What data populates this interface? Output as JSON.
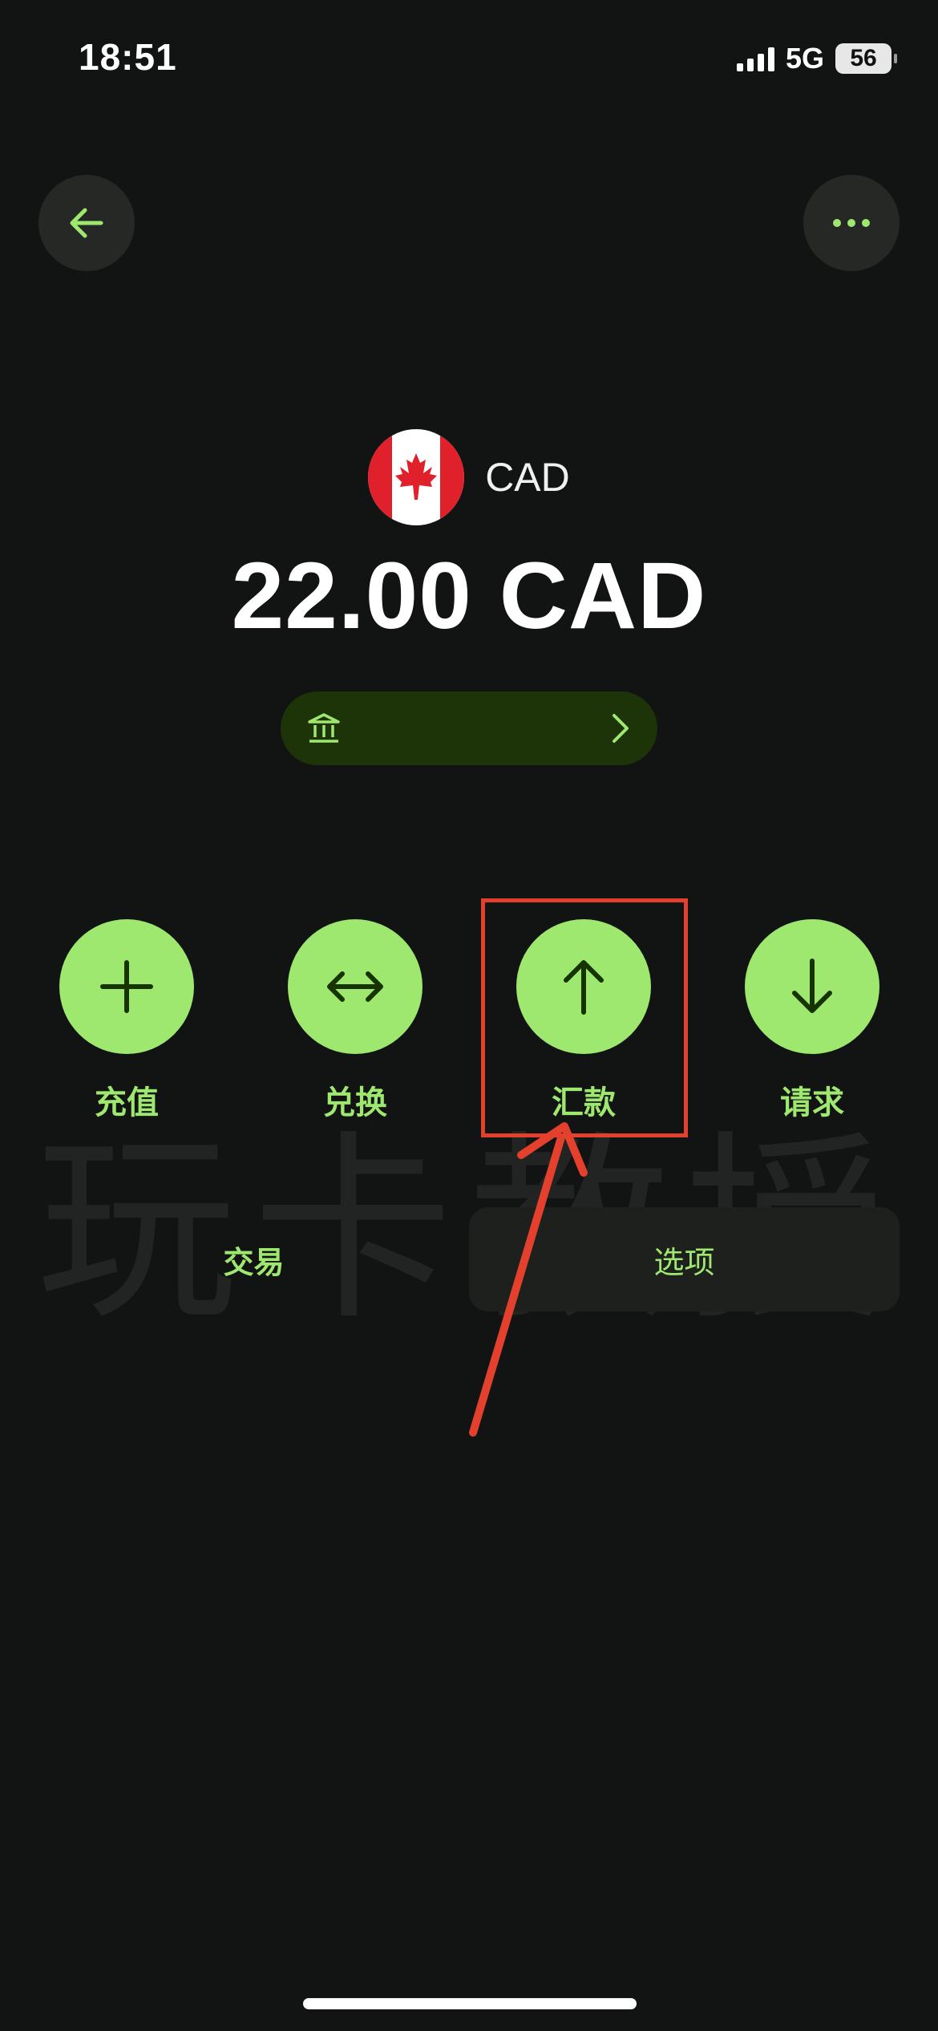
{
  "status_bar": {
    "time": "18:51",
    "network": "5G",
    "battery": "56"
  },
  "header": {
    "back_icon": "arrow-left-icon",
    "more_icon": "more-horizontal-icon"
  },
  "account": {
    "flag_icon": "canada-flag-icon",
    "currency_code": "CAD",
    "balance": "22.00 CAD",
    "bank_icon": "bank-icon",
    "chevron_icon": "chevron-right-icon"
  },
  "actions": [
    {
      "label": "充值",
      "icon": "plus-icon"
    },
    {
      "label": "兑换",
      "icon": "swap-horizontal-icon"
    },
    {
      "label": "汇款",
      "icon": "arrow-up-icon"
    },
    {
      "label": "请求",
      "icon": "arrow-down-icon"
    }
  ],
  "tabs": [
    {
      "label": "交易",
      "selected": true
    },
    {
      "label": "选项",
      "selected": false
    }
  ],
  "watermark": "玩卡教授",
  "colors": {
    "background": "#121413",
    "accent": "#9fe870",
    "accent_dark": "#1d3308",
    "annotation": "#e3402d"
  }
}
